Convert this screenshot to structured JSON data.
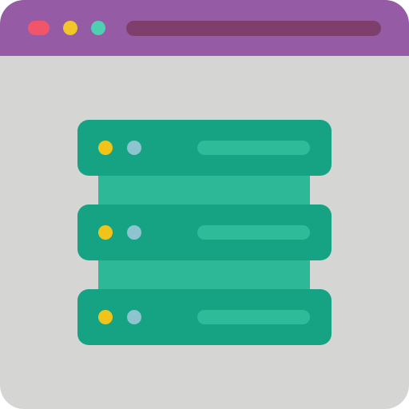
{
  "colors": {
    "titlebar": "#955BA5",
    "address_bar": "#7F3F6C",
    "window_body": "#D5D6D3",
    "close_dot": "#F0556A",
    "minimize_dot": "#F1C629",
    "maximize_dot": "#4FCFB2",
    "server_unit": "#15A383",
    "server_connector": "#2DB997",
    "led_yellow": "#F0C419",
    "led_blue": "#8CC4CF",
    "drive_bay": "#2DBB99"
  },
  "window": {
    "controls": [
      {
        "name": "close",
        "icon": "close-dot-icon"
      },
      {
        "name": "minimize",
        "icon": "minimize-dot-icon"
      },
      {
        "name": "maximize",
        "icon": "maximize-dot-icon"
      }
    ],
    "address_bar_icon": "address-bar"
  },
  "server": {
    "icon": "server-rack-icon",
    "units": [
      {
        "name": "top",
        "leds": [
          "yellow",
          "blue"
        ]
      },
      {
        "name": "middle",
        "leds": [
          "yellow",
          "blue"
        ]
      },
      {
        "name": "bottom",
        "leds": [
          "yellow",
          "blue"
        ]
      }
    ]
  }
}
